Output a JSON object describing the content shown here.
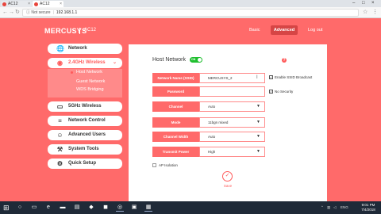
{
  "browser": {
    "tabs": [
      {
        "title": "AC12"
      },
      {
        "title": "AC12"
      }
    ],
    "address": {
      "security": "Not secure",
      "url": "192.168.1.1"
    }
  },
  "header": {
    "brand": "MERCUSYS",
    "model": "AC12",
    "nav": {
      "basic": "Basic",
      "advanced": "Advanced",
      "logout": "Log out"
    }
  },
  "sidebar": {
    "items": [
      {
        "label": "Network"
      },
      {
        "label": "2.4GHz Wireless",
        "sub": [
          "Host Network",
          "Guest Network",
          "WDS Bridging"
        ]
      },
      {
        "label": "5GHz Wireless"
      },
      {
        "label": "Network Control"
      },
      {
        "label": "Advanced Users"
      },
      {
        "label": "System Tools"
      },
      {
        "label": "Quick Setup"
      }
    ]
  },
  "main": {
    "title": "Host Network",
    "toggle_label": "ON",
    "fields": {
      "ssid": {
        "label": "Network Name (SSID)",
        "value": "MERCUSYS_2",
        "checkbox": "Enable SSID Broadcast"
      },
      "password": {
        "label": "Password",
        "value": "",
        "checkbox": "No Security"
      },
      "channel": {
        "label": "Channel",
        "value": "Auto"
      },
      "mode": {
        "label": "Mode",
        "value": "11bgn mixed"
      },
      "channel_width": {
        "label": "Channel Width",
        "value": "Auto"
      },
      "transmit_power": {
        "label": "Transmit Power",
        "value": "High"
      }
    },
    "ap_isolation": "AP Isolation",
    "save": "Save"
  },
  "taskbar": {
    "lang": "ENG",
    "time": "9:01 PM",
    "date": "7/4/2018"
  },
  "colors": {
    "brand": "#ff6a6a",
    "accent": "#ff5a5a",
    "toggle_on": "#1fbf2f"
  }
}
